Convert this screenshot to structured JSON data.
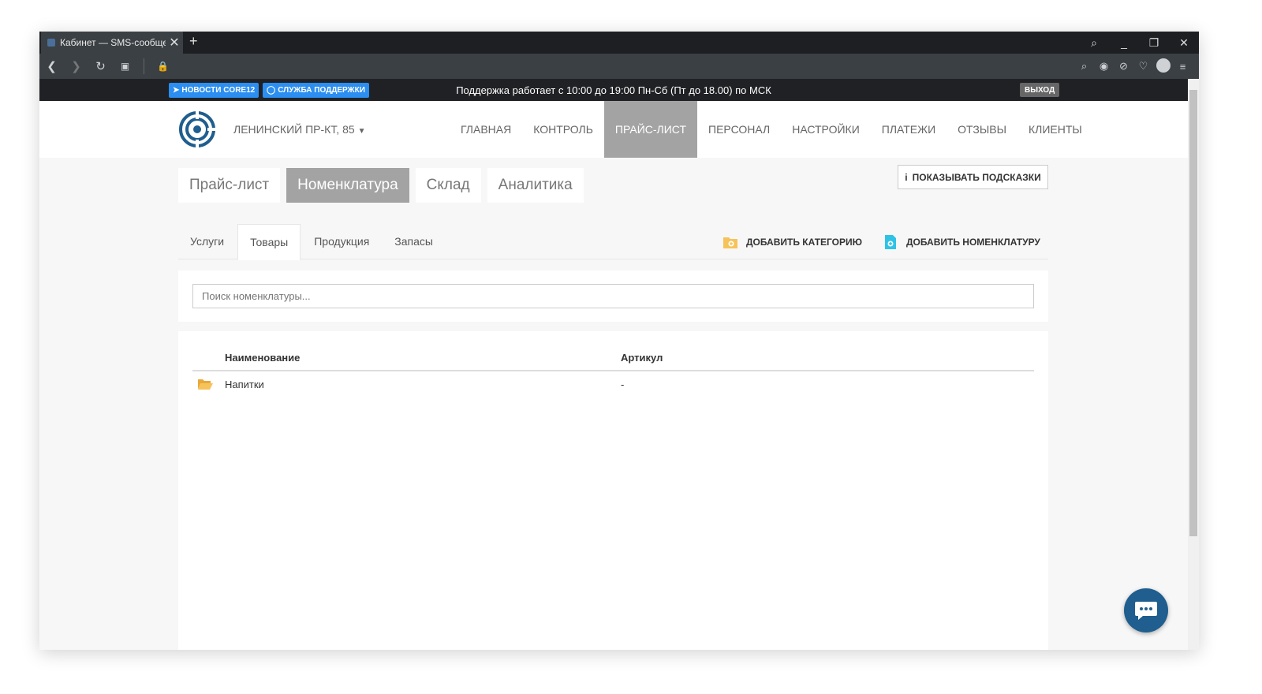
{
  "browser": {
    "tab_title": "Кабинет — SMS-сообщения",
    "new_tab": "+",
    "close_tab": "✕",
    "window_controls": [
      "⌕",
      "_",
      "❐",
      "✕"
    ]
  },
  "notice": {
    "news_label": "НОВОСТИ CORE12",
    "support_label": "СЛУЖБА ПОДДЕРЖКИ",
    "message": "Поддержка работает с 10:00 до 19:00 Пн-Сб (Пт до 18.00) по МСК",
    "exit_label": "ВЫХОД"
  },
  "header": {
    "location": "ЛЕНИНСКИЙ ПР-КТ, 85",
    "menu": [
      "ГЛАВНАЯ",
      "КОНТРОЛЬ",
      "ПРАЙС-ЛИСТ",
      "ПЕРСОНАЛ",
      "НАСТРОЙКИ",
      "ПЛАТЕЖИ",
      "ОТЗЫВЫ",
      "КЛИЕНТЫ"
    ]
  },
  "subtabs": [
    "Прайс-лист",
    "Номенклатура",
    "Склад",
    "Аналитика"
  ],
  "hints_button": "ПОКАЗЫВАТЬ ПОДСКАЗКИ",
  "category_tabs": [
    "Услуги",
    "Товары",
    "Продукция",
    "Запасы"
  ],
  "actions": {
    "add_category": "ДОБАВИТЬ КАТЕГОРИЮ",
    "add_nomenclature": "ДОБАВИТЬ НОМЕНКЛАТУРУ"
  },
  "search": {
    "placeholder": "Поиск номенклатуры..."
  },
  "table": {
    "headers": [
      "Наименование",
      "Артикул"
    ],
    "rows": [
      {
        "name": "Напитки",
        "article": "-"
      }
    ]
  },
  "colors": {
    "accent_badge": "#2b8ef0",
    "active_menu": "#a3a3a3",
    "logo": "#1f5e8e",
    "folder": "#f6c35b",
    "add_nomenclature_icon": "#2ec3e6"
  }
}
